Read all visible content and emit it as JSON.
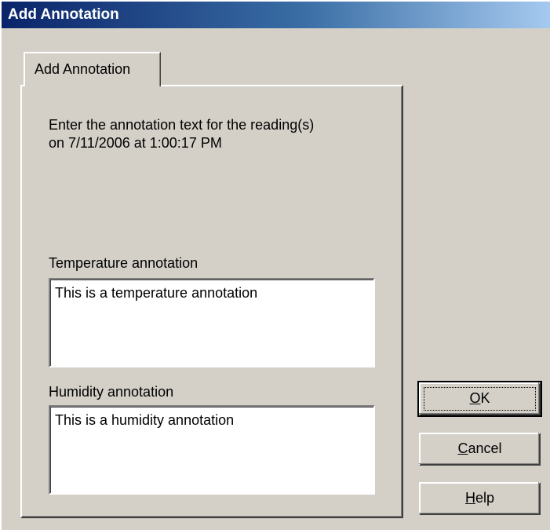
{
  "window": {
    "title": "Add Annotation"
  },
  "tab": {
    "label": "Add Annotation"
  },
  "instructions": {
    "line1": "Enter the annotation text for the reading(s)",
    "line2": "on 7/11/2006 at 1:00:17 PM"
  },
  "temperature": {
    "label": "Temperature annotation",
    "value": "This is a temperature annotation"
  },
  "humidity": {
    "label": "Humidity annotation",
    "value": "This is a humidity annotation"
  },
  "buttons": {
    "ok": {
      "mnemonic": "O",
      "rest": "K"
    },
    "cancel": {
      "mnemonic": "C",
      "rest": "ancel"
    },
    "help": {
      "mnemonic": "H",
      "rest": "elp"
    }
  },
  "colors": {
    "face": "#d4d0c8",
    "title_start": "#0a246a",
    "title_end": "#a6caf0"
  }
}
